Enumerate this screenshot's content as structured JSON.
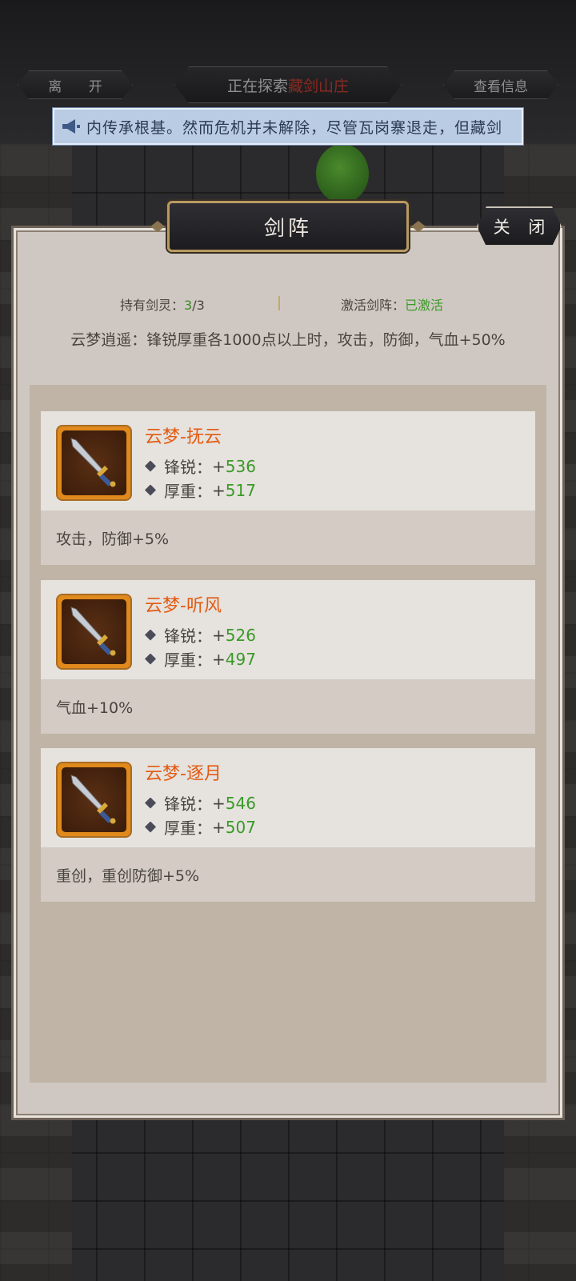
{
  "header": {
    "leave_label": "离 开",
    "explore_prefix": "正在探索",
    "explore_place": "藏剑山庄",
    "info_label": "查看信息"
  },
  "marquee": {
    "icon": "megaphone-icon",
    "text": "内传承根基。然而危机并未解除，尽管瓦岗寨退走，但藏剑"
  },
  "panel": {
    "title": "剑阵",
    "close_label": "关 闭",
    "held_label": "持有剑灵：",
    "held_count": "3",
    "held_total": "/3",
    "active_label": "激活剑阵：",
    "active_value": "已激活",
    "formation_desc": "云梦逍遥：锋锐厚重各1000点以上时，攻击，防御，气血+50%"
  },
  "swords": [
    {
      "name": "云梦-抚云",
      "attr1_label": "锋锐：",
      "attr1_value": "536",
      "attr2_label": "厚重：",
      "attr2_value": "517",
      "bonus": "攻击，防御+5%",
      "icon": "sword-icon"
    },
    {
      "name": "云梦-听风",
      "attr1_label": "锋锐：",
      "attr1_value": "526",
      "attr2_label": "厚重：",
      "attr2_value": "497",
      "bonus": "气血+10%",
      "icon": "sword-icon"
    },
    {
      "name": "云梦-逐月",
      "attr1_label": "锋锐：",
      "attr1_value": "546",
      "attr2_label": "厚重：",
      "attr2_value": "507",
      "bonus": "重创，重创防御+5%",
      "icon": "sword-icon"
    }
  ],
  "colors": {
    "sword_name": "#e25b12",
    "stat_value": "#3a9a28",
    "explore_place": "#8a2a22",
    "marquee_bg": "#b9cce3"
  }
}
